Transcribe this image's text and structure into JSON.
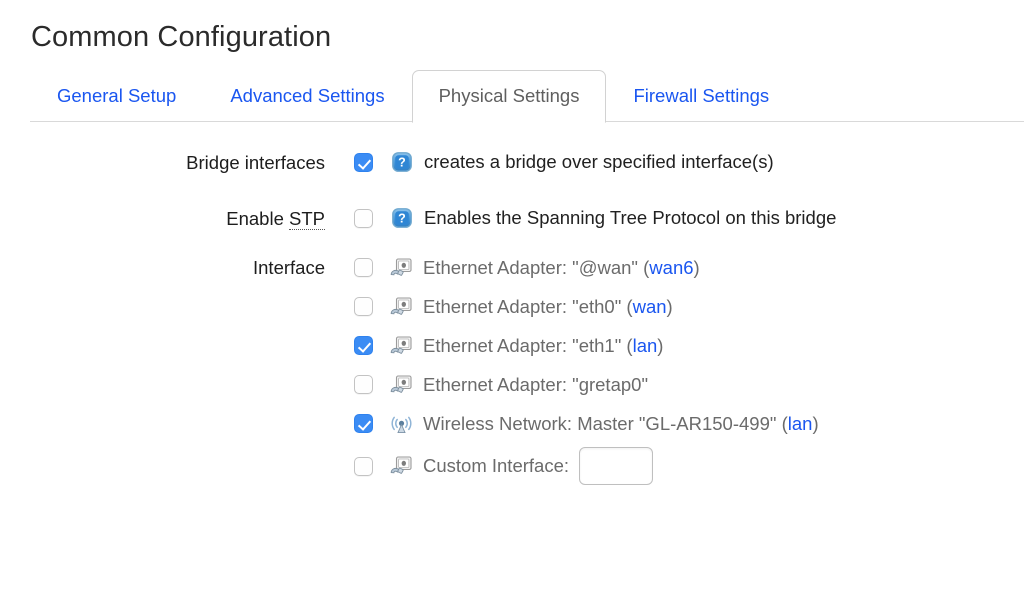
{
  "page": {
    "title": "Common Configuration"
  },
  "tabs": [
    {
      "label": "General Setup",
      "active": false
    },
    {
      "label": "Advanced Settings",
      "active": false
    },
    {
      "label": "Physical Settings",
      "active": true
    },
    {
      "label": "Firewall Settings",
      "active": false
    }
  ],
  "colors": {
    "link": "#1a56f0",
    "checkbox_checked": "#3b8cf4",
    "active_tab_text": "#5f5f5f",
    "list_text": "#6b6b6b",
    "border": "#d2d2d2"
  },
  "form": {
    "bridge": {
      "label": "Bridge interfaces",
      "checked": true,
      "help_icon": "help-question-icon",
      "description": "creates a bridge over specified interface(s)"
    },
    "stp": {
      "label_prefix": "Enable ",
      "label_abbr": "STP",
      "checked": false,
      "help_icon": "help-question-icon",
      "description": "Enables the Spanning Tree Protocol on this bridge"
    },
    "interface": {
      "label": "Interface",
      "items": [
        {
          "checked": false,
          "icon": "ethernet-adapter-icon",
          "text": "Ethernet Adapter: \"@wan\" (",
          "network": "wan6",
          "text_after": ")"
        },
        {
          "checked": false,
          "icon": "ethernet-adapter-icon",
          "text": "Ethernet Adapter: \"eth0\" (",
          "network": "wan",
          "text_after": ")"
        },
        {
          "checked": true,
          "icon": "ethernet-adapter-icon",
          "text": "Ethernet Adapter: \"eth1\" (",
          "network": "lan",
          "text_after": ")"
        },
        {
          "checked": false,
          "icon": "ethernet-adapter-icon",
          "text": "Ethernet Adapter: \"gretap0\"",
          "network": "",
          "text_after": ""
        },
        {
          "checked": true,
          "icon": "wireless-network-icon",
          "text": "Wireless Network: Master \"GL-AR150-499\" (",
          "network": "lan",
          "text_after": ")"
        }
      ],
      "custom": {
        "checked": false,
        "icon": "ethernet-adapter-icon",
        "label": "Custom Interface:",
        "value": "",
        "placeholder": ""
      }
    }
  }
}
